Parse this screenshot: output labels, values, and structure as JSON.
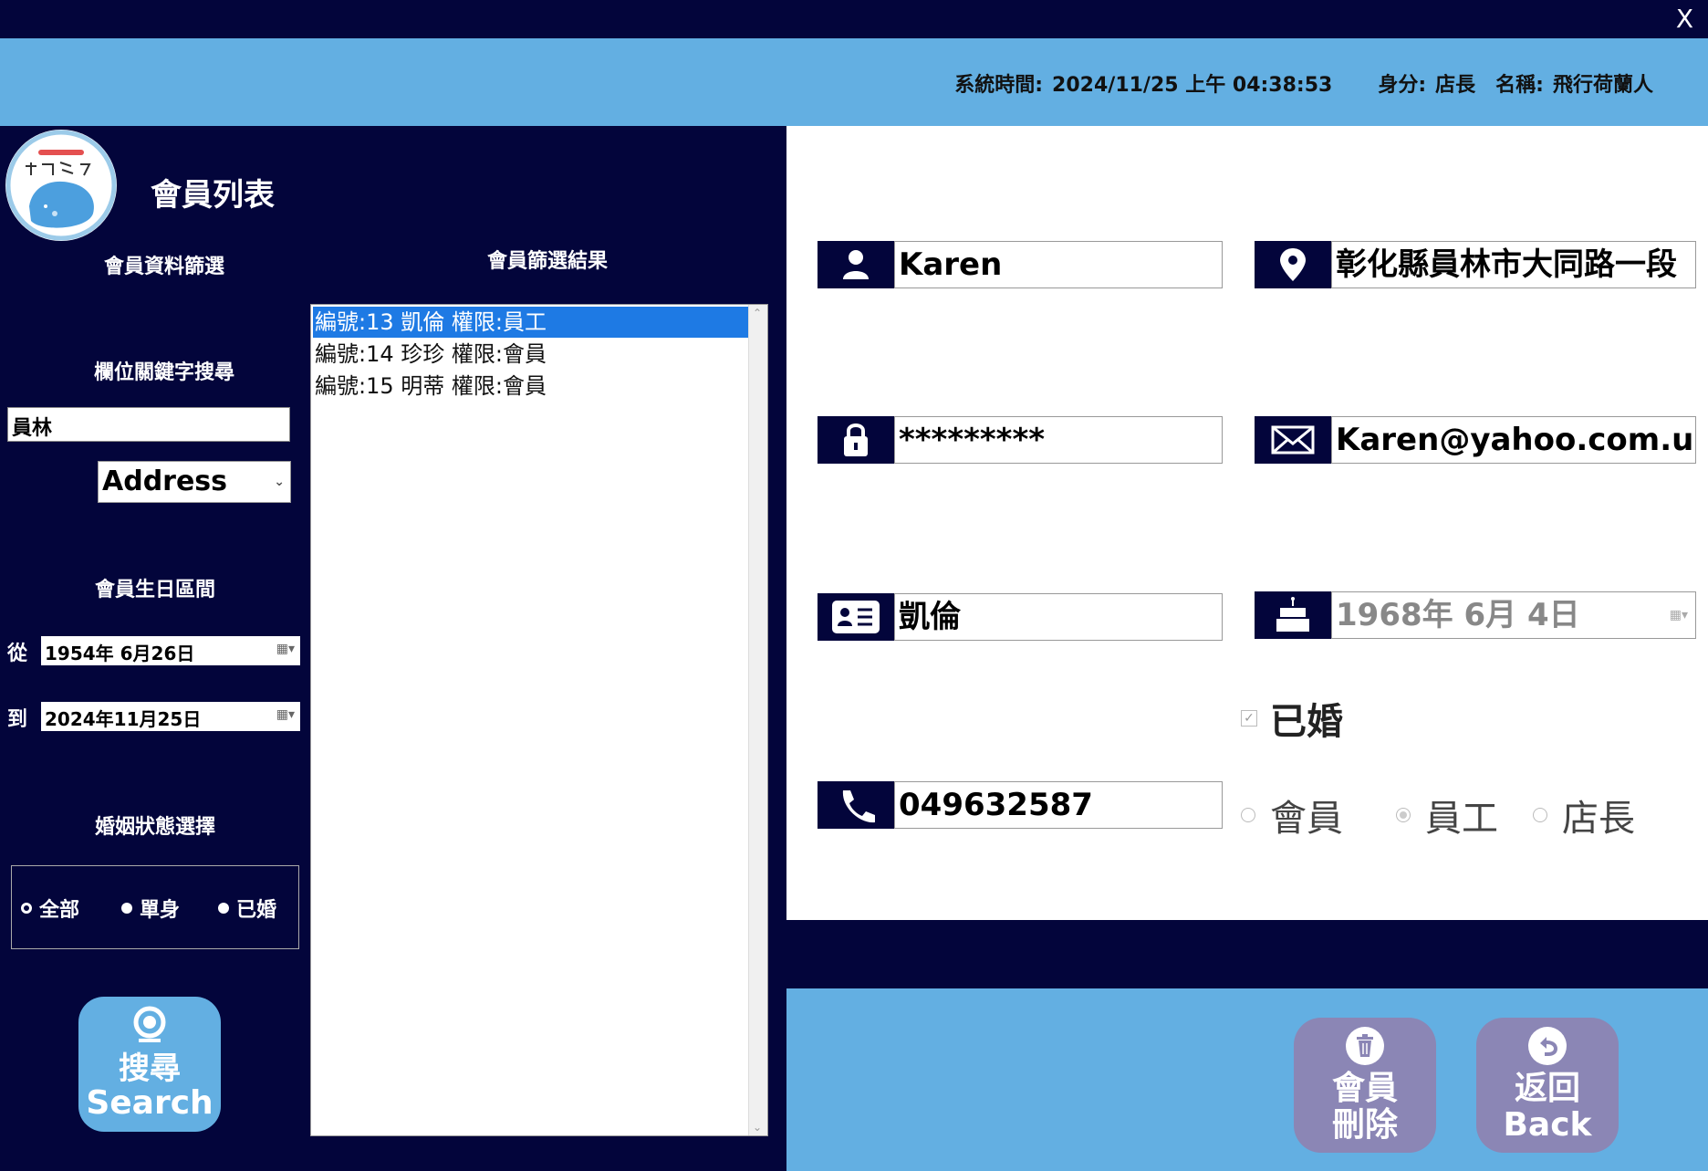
{
  "window": {
    "close_label": "X"
  },
  "header": {
    "time_label": "系統時間:",
    "time_value": "2024/11/25 上午 04:38:53",
    "role_label": "身分:",
    "role_value": "店長",
    "name_label": "名稱:",
    "name_value": "飛行荷蘭人"
  },
  "page_title": "會員列表",
  "filter": {
    "title": "會員資料篩選",
    "keyword_title": "欄位關鍵字搜尋",
    "keyword_value": "員林",
    "field_selected": "Address",
    "birthday_title": "會員生日區間",
    "from_label": "從",
    "from_date": "1954年  6月26日",
    "to_label": "到",
    "to_date": "2024年11月25日",
    "marital_title": "婚姻狀態選擇",
    "marital_options": [
      "全部",
      "單身",
      "已婚"
    ],
    "marital_selected": "全部"
  },
  "search_button": {
    "label_zh": "搜尋",
    "label_en": "Search"
  },
  "results": {
    "title": "會員篩選結果",
    "items": [
      "編號:13 凱倫 權限:員工",
      "編號:14 珍珍 權限:會員",
      "編號:15 明蒂 權限:會員"
    ],
    "selected_index": 0
  },
  "detail": {
    "username": "Karen",
    "address": "彰化縣員林市大同路一段",
    "password": "*********",
    "email": "Karen@yahoo.com.us",
    "real_name": "凱倫",
    "birthday": "1968年  6月  4日",
    "married_label": "已婚",
    "married_checked": true,
    "phone": "049632587",
    "roles": [
      "會員",
      "員工",
      "店長"
    ],
    "role_selected": "員工"
  },
  "actions": {
    "delete_line1": "會員",
    "delete_line2": "刪除",
    "back_line1": "返回",
    "back_line2": "Back"
  },
  "colors": {
    "navy": "#03053b",
    "sky": "#63afe2",
    "button_purple": "#8b86b5",
    "selection": "#1e7ae4"
  }
}
